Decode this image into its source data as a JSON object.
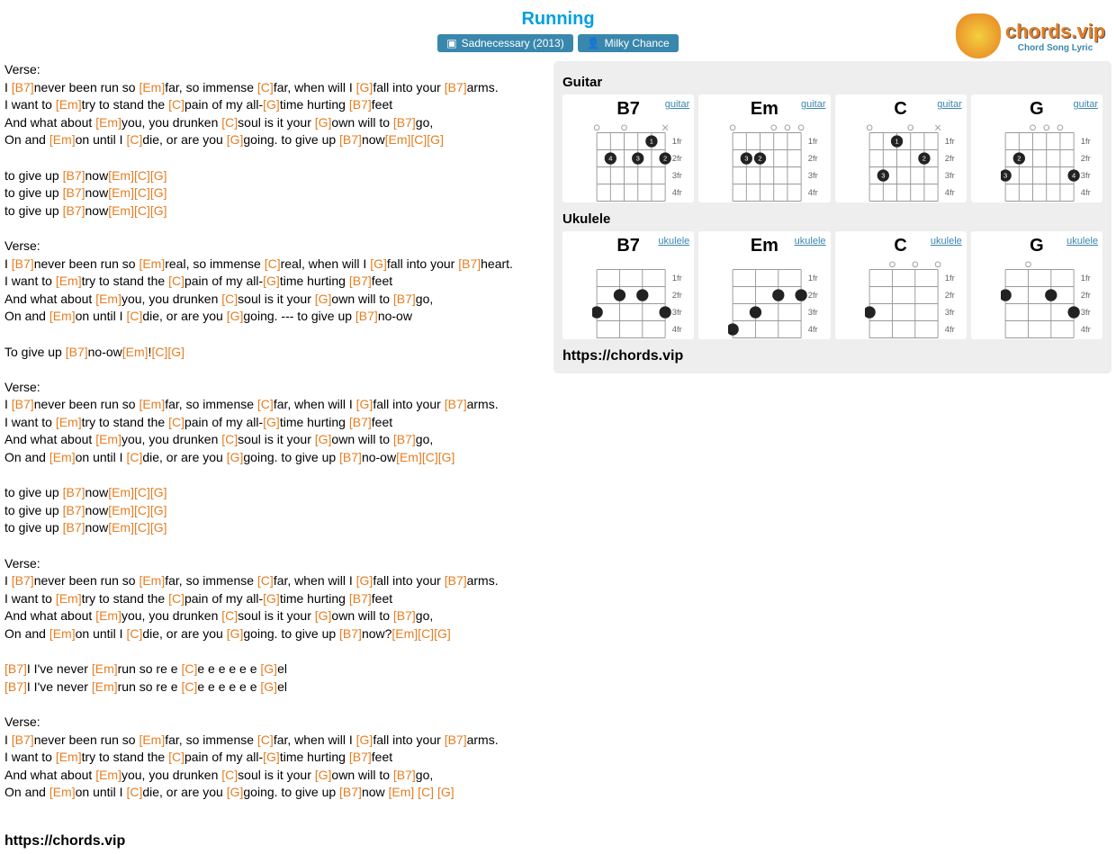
{
  "title": "Running",
  "album": "Sadnecessary (2013)",
  "artist": "Milky Chance",
  "logo_text": "chords.vip",
  "logo_sub": "Chord Song Lyric",
  "url": "https://chords.vip",
  "guitar_label": "Guitar",
  "ukulele_label": "Ukulele",
  "instr_guitar": "guitar",
  "instr_uke": "ukulele",
  "chords": [
    "B7",
    "Em",
    "C",
    "G"
  ],
  "frets": [
    "1fr",
    "2fr",
    "3fr",
    "4fr"
  ],
  "lyrics": [
    {
      "section": "Verse:",
      "lines": [
        [
          {
            "t": "I "
          },
          {
            "c": "[B7]"
          },
          {
            "t": "never been run so "
          },
          {
            "c": "[Em]"
          },
          {
            "t": "far, so immense "
          },
          {
            "c": "[C]"
          },
          {
            "t": "far, when will I "
          },
          {
            "c": "[G]"
          },
          {
            "t": "fall into your "
          },
          {
            "c": "[B7]"
          },
          {
            "t": "arms."
          }
        ],
        [
          {
            "t": "I want to "
          },
          {
            "c": "[Em]"
          },
          {
            "t": "try to stand the "
          },
          {
            "c": "[C]"
          },
          {
            "t": "pain of my all-"
          },
          {
            "c": "[G]"
          },
          {
            "t": "time hurting "
          },
          {
            "c": "[B7]"
          },
          {
            "t": "feet"
          }
        ],
        [
          {
            "t": "And what about "
          },
          {
            "c": "[Em]"
          },
          {
            "t": "you, you drunken "
          },
          {
            "c": "[C]"
          },
          {
            "t": "soul is it your "
          },
          {
            "c": "[G]"
          },
          {
            "t": "own will to "
          },
          {
            "c": "[B7]"
          },
          {
            "t": "go,"
          }
        ],
        [
          {
            "t": "On and "
          },
          {
            "c": "[Em]"
          },
          {
            "t": "on until I "
          },
          {
            "c": "[C]"
          },
          {
            "t": "die, or are you "
          },
          {
            "c": "[G]"
          },
          {
            "t": "going. to give up "
          },
          {
            "c": "[B7]"
          },
          {
            "t": "now"
          },
          {
            "c": "[Em][C][G]"
          }
        ]
      ]
    },
    {
      "section": "",
      "lines": [
        [
          {
            "t": "to give up "
          },
          {
            "c": "[B7]"
          },
          {
            "t": "now"
          },
          {
            "c": "[Em][C][G]"
          }
        ],
        [
          {
            "t": "to give up "
          },
          {
            "c": "[B7]"
          },
          {
            "t": "now"
          },
          {
            "c": "[Em][C][G]"
          }
        ],
        [
          {
            "t": "to give up "
          },
          {
            "c": "[B7]"
          },
          {
            "t": "now"
          },
          {
            "c": "[Em][C][G]"
          }
        ]
      ]
    },
    {
      "section": "Verse:",
      "lines": [
        [
          {
            "t": "I "
          },
          {
            "c": "[B7]"
          },
          {
            "t": "never been run so "
          },
          {
            "c": "[Em]"
          },
          {
            "t": "real, so immense "
          },
          {
            "c": "[C]"
          },
          {
            "t": "real, when will I "
          },
          {
            "c": "[G]"
          },
          {
            "t": "fall into your "
          },
          {
            "c": "[B7]"
          },
          {
            "t": "heart."
          }
        ],
        [
          {
            "t": "I want to "
          },
          {
            "c": "[Em]"
          },
          {
            "t": "try to stand the "
          },
          {
            "c": "[C]"
          },
          {
            "t": "pain of my all-"
          },
          {
            "c": "[G]"
          },
          {
            "t": "time hurting "
          },
          {
            "c": "[B7]"
          },
          {
            "t": "feet"
          }
        ],
        [
          {
            "t": "And what about "
          },
          {
            "c": "[Em]"
          },
          {
            "t": "you, you drunken "
          },
          {
            "c": "[C]"
          },
          {
            "t": "soul is it your "
          },
          {
            "c": "[G]"
          },
          {
            "t": "own will to "
          },
          {
            "c": "[B7]"
          },
          {
            "t": "go,"
          }
        ],
        [
          {
            "t": "On and "
          },
          {
            "c": "[Em]"
          },
          {
            "t": "on until I "
          },
          {
            "c": "[C]"
          },
          {
            "t": "die, or are you "
          },
          {
            "c": "[G]"
          },
          {
            "t": "going. --- to give up "
          },
          {
            "c": "[B7]"
          },
          {
            "t": "no-ow"
          }
        ]
      ]
    },
    {
      "section": "",
      "lines": [
        [
          {
            "t": "To give up "
          },
          {
            "c": "[B7]"
          },
          {
            "t": "no-ow"
          },
          {
            "c": "[Em]"
          },
          {
            "t": "!"
          },
          {
            "c": "[C][G]"
          }
        ]
      ]
    },
    {
      "section": "Verse:",
      "lines": [
        [
          {
            "t": "I "
          },
          {
            "c": "[B7]"
          },
          {
            "t": "never been run so "
          },
          {
            "c": "[Em]"
          },
          {
            "t": "far, so immense "
          },
          {
            "c": "[C]"
          },
          {
            "t": "far, when will I "
          },
          {
            "c": "[G]"
          },
          {
            "t": "fall into your "
          },
          {
            "c": "[B7]"
          },
          {
            "t": "arms."
          }
        ],
        [
          {
            "t": "I want to "
          },
          {
            "c": "[Em]"
          },
          {
            "t": "try to stand the "
          },
          {
            "c": "[C]"
          },
          {
            "t": "pain of my all-"
          },
          {
            "c": "[G]"
          },
          {
            "t": "time hurting "
          },
          {
            "c": "[B7]"
          },
          {
            "t": "feet"
          }
        ],
        [
          {
            "t": "And what about "
          },
          {
            "c": "[Em]"
          },
          {
            "t": "you, you drunken "
          },
          {
            "c": "[C]"
          },
          {
            "t": "soul is it your "
          },
          {
            "c": "[G]"
          },
          {
            "t": "own will to "
          },
          {
            "c": "[B7]"
          },
          {
            "t": "go,"
          }
        ],
        [
          {
            "t": "On and "
          },
          {
            "c": "[Em]"
          },
          {
            "t": "on until I "
          },
          {
            "c": "[C]"
          },
          {
            "t": "die, or are you "
          },
          {
            "c": "[G]"
          },
          {
            "t": "going. to give up "
          },
          {
            "c": "[B7]"
          },
          {
            "t": "no-ow"
          },
          {
            "c": "[Em][C][G]"
          }
        ]
      ]
    },
    {
      "section": "",
      "lines": [
        [
          {
            "t": "to give up "
          },
          {
            "c": "[B7]"
          },
          {
            "t": "now"
          },
          {
            "c": "[Em][C][G]"
          }
        ],
        [
          {
            "t": "to give up "
          },
          {
            "c": "[B7]"
          },
          {
            "t": "now"
          },
          {
            "c": "[Em][C][G]"
          }
        ],
        [
          {
            "t": "to give up "
          },
          {
            "c": "[B7]"
          },
          {
            "t": "now"
          },
          {
            "c": "[Em][C][G]"
          }
        ]
      ]
    },
    {
      "section": "Verse:",
      "lines": [
        [
          {
            "t": "I "
          },
          {
            "c": "[B7]"
          },
          {
            "t": "never been run so "
          },
          {
            "c": "[Em]"
          },
          {
            "t": "far, so immense "
          },
          {
            "c": "[C]"
          },
          {
            "t": "far, when will I "
          },
          {
            "c": "[G]"
          },
          {
            "t": "fall into your "
          },
          {
            "c": "[B7]"
          },
          {
            "t": "arms."
          }
        ],
        [
          {
            "t": "I want to "
          },
          {
            "c": "[Em]"
          },
          {
            "t": "try to stand the "
          },
          {
            "c": "[C]"
          },
          {
            "t": "pain of my all-"
          },
          {
            "c": "[G]"
          },
          {
            "t": "time hurting "
          },
          {
            "c": "[B7]"
          },
          {
            "t": "feet"
          }
        ],
        [
          {
            "t": "And what about "
          },
          {
            "c": "[Em]"
          },
          {
            "t": "you, you drunken "
          },
          {
            "c": "[C]"
          },
          {
            "t": "soul is it your "
          },
          {
            "c": "[G]"
          },
          {
            "t": "own will to "
          },
          {
            "c": "[B7]"
          },
          {
            "t": "go,"
          }
        ],
        [
          {
            "t": "On and "
          },
          {
            "c": "[Em]"
          },
          {
            "t": "on until I "
          },
          {
            "c": "[C]"
          },
          {
            "t": "die, or are you "
          },
          {
            "c": "[G]"
          },
          {
            "t": "going. to give up "
          },
          {
            "c": "[B7]"
          },
          {
            "t": "now?"
          },
          {
            "c": "[Em][C][G]"
          }
        ]
      ]
    },
    {
      "section": "",
      "lines": [
        [
          {
            "c": "[B7]"
          },
          {
            "t": "I I've never "
          },
          {
            "c": "[Em]"
          },
          {
            "t": "run so re e "
          },
          {
            "c": "[C]"
          },
          {
            "t": "e e e e e e "
          },
          {
            "c": "[G]"
          },
          {
            "t": "el"
          }
        ],
        [
          {
            "c": "[B7]"
          },
          {
            "t": "I I've never "
          },
          {
            "c": "[Em]"
          },
          {
            "t": "run so re e "
          },
          {
            "c": "[C]"
          },
          {
            "t": "e e e e e e "
          },
          {
            "c": "[G]"
          },
          {
            "t": "el"
          }
        ]
      ]
    },
    {
      "section": "Verse:",
      "lines": [
        [
          {
            "t": "I "
          },
          {
            "c": "[B7]"
          },
          {
            "t": "never been run so "
          },
          {
            "c": "[Em]"
          },
          {
            "t": "far, so immense "
          },
          {
            "c": "[C]"
          },
          {
            "t": "far, when will I "
          },
          {
            "c": "[G]"
          },
          {
            "t": "fall into your "
          },
          {
            "c": "[B7]"
          },
          {
            "t": "arms."
          }
        ],
        [
          {
            "t": "I want to "
          },
          {
            "c": "[Em]"
          },
          {
            "t": "try to stand the "
          },
          {
            "c": "[C]"
          },
          {
            "t": "pain of my all-"
          },
          {
            "c": "[G]"
          },
          {
            "t": "time hurting "
          },
          {
            "c": "[B7]"
          },
          {
            "t": "feet"
          }
        ],
        [
          {
            "t": "And what about "
          },
          {
            "c": "[Em]"
          },
          {
            "t": "you, you drunken "
          },
          {
            "c": "[C]"
          },
          {
            "t": "soul is it your "
          },
          {
            "c": "[G]"
          },
          {
            "t": "own will to "
          },
          {
            "c": "[B7]"
          },
          {
            "t": "go,"
          }
        ],
        [
          {
            "t": "On and "
          },
          {
            "c": "[Em]"
          },
          {
            "t": "on until I "
          },
          {
            "c": "[C]"
          },
          {
            "t": "die, or are you "
          },
          {
            "c": "[G]"
          },
          {
            "t": "going. to give up "
          },
          {
            "c": "[B7]"
          },
          {
            "t": "now "
          },
          {
            "c": "[Em] [C] [G]"
          }
        ]
      ]
    }
  ],
  "guitar_diagrams": {
    "B7": {
      "mute": [
        0
      ],
      "open": [
        3,
        5
      ],
      "dots": [
        [
          1,
          1,
          "1"
        ],
        [
          0,
          2,
          "2"
        ],
        [
          2,
          2,
          "3"
        ],
        [
          4,
          2,
          "4"
        ]
      ]
    },
    "Em": {
      "open": [
        0,
        1,
        2,
        5
      ],
      "dots": [
        [
          3,
          2,
          "2"
        ],
        [
          4,
          2,
          "3"
        ]
      ]
    },
    "C": {
      "mute": [
        0
      ],
      "open": [
        2,
        5
      ],
      "dots": [
        [
          3,
          1,
          "1"
        ],
        [
          1,
          2,
          "2"
        ],
        [
          4,
          3,
          "3"
        ]
      ]
    },
    "G": {
      "open": [
        1,
        2,
        3
      ],
      "dots": [
        [
          4,
          2,
          "2"
        ],
        [
          5,
          3,
          "3"
        ],
        [
          0,
          3,
          "4"
        ]
      ]
    }
  },
  "uke_diagrams": {
    "B7": {
      "dots": [
        [
          1,
          2,
          ""
        ],
        [
          2,
          2,
          ""
        ],
        [
          0,
          3,
          ""
        ],
        [
          3,
          3,
          ""
        ]
      ]
    },
    "Em": {
      "dots": [
        [
          0,
          2,
          ""
        ],
        [
          1,
          2,
          ""
        ],
        [
          2,
          3,
          ""
        ],
        [
          3,
          4,
          ""
        ]
      ]
    },
    "C": {
      "open": [
        0,
        1,
        2
      ],
      "dots": [
        [
          3,
          3,
          ""
        ]
      ]
    },
    "G": {
      "open": [
        2
      ],
      "dots": [
        [
          1,
          2,
          ""
        ],
        [
          3,
          2,
          ""
        ],
        [
          0,
          3,
          ""
        ]
      ]
    }
  }
}
